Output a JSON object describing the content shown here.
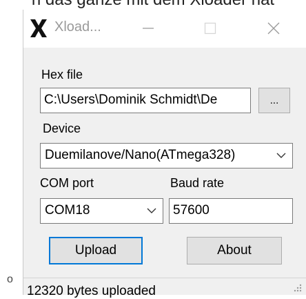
{
  "background": {
    "text": "n das ganze mit dem Xloader hat",
    "stray_char": "o"
  },
  "window": {
    "title": "Xload...",
    "icon": "xloader-x-icon",
    "controls": [
      "minimize-icon",
      "maximize-icon",
      "close-icon"
    ]
  },
  "form": {
    "hex_file_label": "Hex file",
    "hex_file_value": "C:\\Users\\Dominik Schmidt\\De",
    "browse_label": "...",
    "device_label": "Device",
    "device_value": "Duemilanove/Nano(ATmega328)",
    "com_port_label": "COM port",
    "com_port_value": "COM18",
    "baud_rate_label": "Baud rate",
    "baud_rate_value": "57600",
    "upload_label": "Upload",
    "about_label": "About"
  },
  "status": {
    "text": "12320 bytes uploaded"
  },
  "colors": {
    "focus_border": "#0078d7",
    "window_bg": "#f0f0f0",
    "button_bg": "#e1e1e1"
  }
}
